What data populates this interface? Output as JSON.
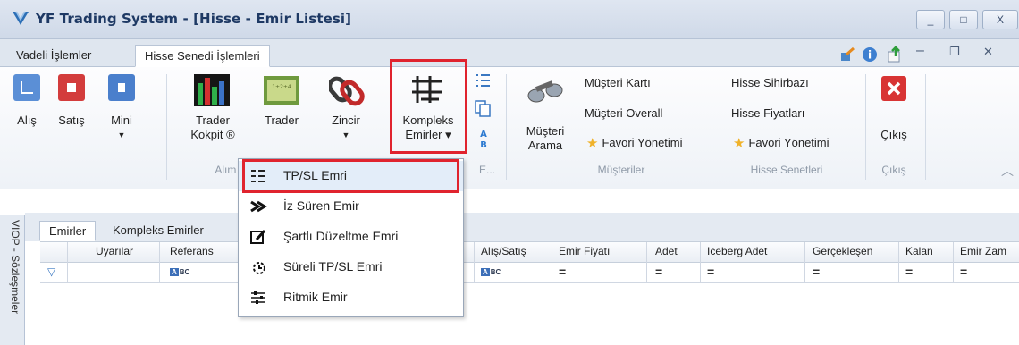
{
  "window": {
    "title": "YF Trading System - [Hisse - Emir Listesi]",
    "controls": [
      "_",
      "□",
      "X"
    ]
  },
  "ribbon_tabs": [
    {
      "label": "Vadeli İşlemler"
    },
    {
      "label": "Hisse Senedi İşlemleri"
    }
  ],
  "ribbon": {
    "buttons": {
      "alis": "Alış",
      "satis": "Satış",
      "mini": "Mini",
      "trader_kokpit_1": "Trader",
      "trader_kokpit_2": "Kokpit ®",
      "trader": "Trader",
      "zincir": "Zincir",
      "kompleks_1": "Kompleks",
      "kompleks_2": "Emirler ▾",
      "musteri_1": "Müşteri",
      "musteri_2": "Arama",
      "cikis": "Çıkış"
    },
    "musteri_items": [
      "Müşteri Kartı",
      "Müşteri Overall",
      "Favori Yönetimi"
    ],
    "hisse_items": [
      "Hisse Sihirbazı",
      "Hisse Fiyatları",
      "Favori Yönetimi"
    ],
    "groups": {
      "alim": "Alım S",
      "e": "E...",
      "musteriler": "Müşteriler",
      "hisse_senetleri": "Hisse Senetleri",
      "cikis": "Çıkış"
    }
  },
  "dropdown_items": [
    {
      "label": "TP/SL Emri"
    },
    {
      "label": "İz Süren Emir"
    },
    {
      "label": "Şartlı Düzeltme Emri"
    },
    {
      "label": "Süreli TP/SL Emri"
    },
    {
      "label": "Ritmik Emir"
    }
  ],
  "side_panel": {
    "label": "VIOP - Sözleşmeler"
  },
  "inner_tabs": [
    {
      "label": "Emirler"
    },
    {
      "label": "Kompleks Emirler"
    }
  ],
  "grid": {
    "columns": [
      "Uyarılar",
      "Referans",
      "Alış/Satış",
      "Emir Fiyatı",
      "Adet",
      "Iceberg Adet",
      "Gerçekleşen",
      "Kalan",
      "Emir Zam"
    ],
    "filter_abc": "BC",
    "filter_abc_prefix": "A",
    "filter_eq": "="
  }
}
